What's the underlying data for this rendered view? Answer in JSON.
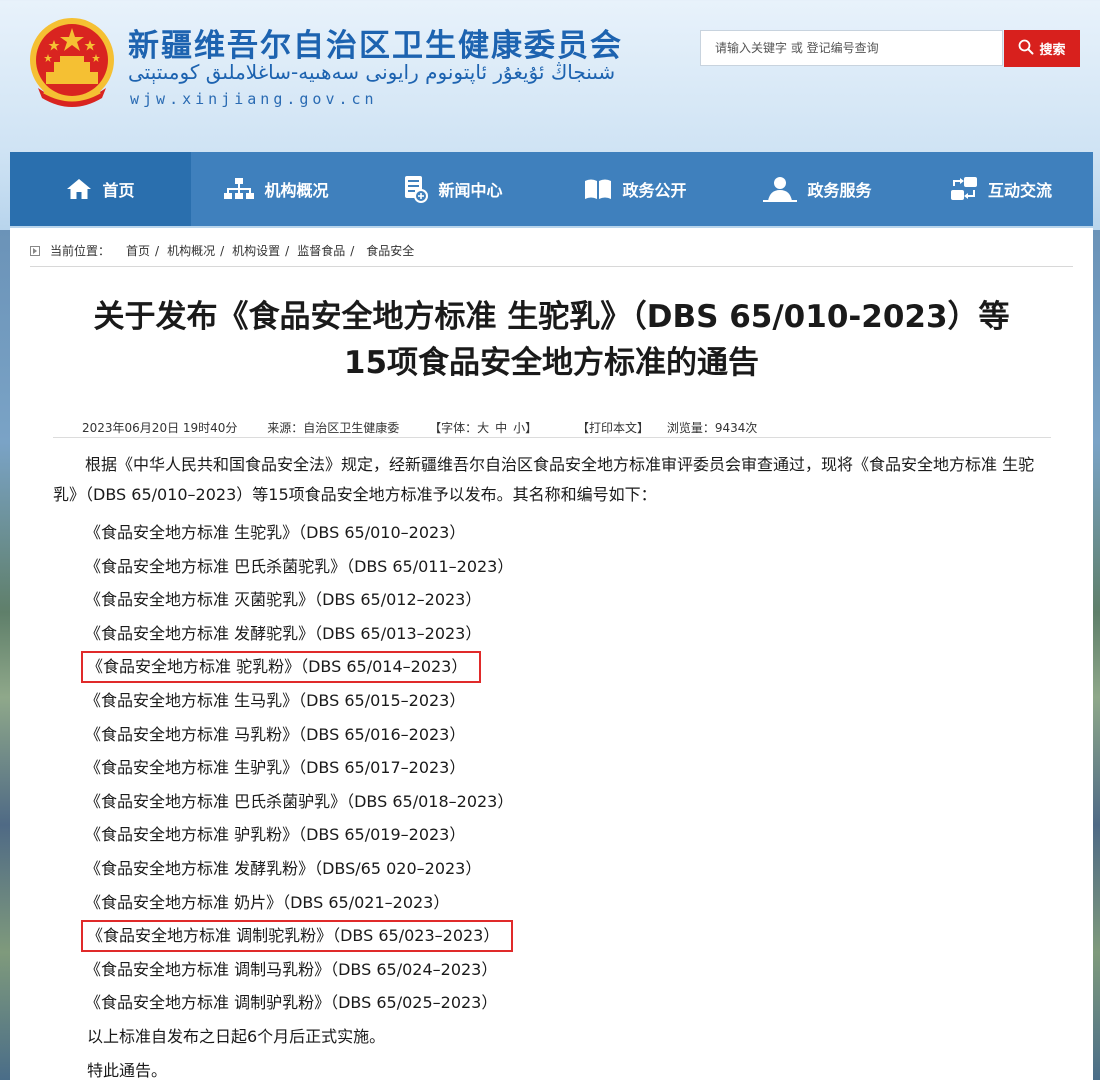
{
  "header": {
    "site_title": "新疆维吾尔自治区卫生健康委员会",
    "site_title_uyghur": "شىنجاڭ ئۇيغۇر ئاپتونوم رايونى سەھىيە-ساغلاملىق كومىتېتى",
    "site_url": "wjw.xinjiang.gov.cn",
    "search_placeholder": "请输入关键字 或 登记编号查询",
    "search_button": "搜索"
  },
  "nav": {
    "items": [
      {
        "label": "首页",
        "icon": "home-icon"
      },
      {
        "label": "机构概况",
        "icon": "org-chart-icon"
      },
      {
        "label": "新闻中心",
        "icon": "news-icon"
      },
      {
        "label": "政务公开",
        "icon": "book-icon"
      },
      {
        "label": "政务服务",
        "icon": "service-icon"
      },
      {
        "label": "互动交流",
        "icon": "exchange-icon"
      }
    ],
    "active_index": 0
  },
  "breadcrumb": {
    "label": "当前位置：",
    "items": [
      "首页",
      "机构概况",
      "机构设置",
      "监督食品",
      "食品安全"
    ]
  },
  "article": {
    "title_line1": "关于发布《食品安全地方标准 生驼乳》（DBS 65/010-2023）等",
    "title_line2": "15项食品安全地方标准的通告",
    "meta": {
      "datetime": "2023年06月20日 19时40分",
      "source": "来源：自治区卫生健康委",
      "font_label": "【字体：",
      "font_large": "大",
      "font_medium": "中",
      "font_small": "小",
      "font_close": "】",
      "print": "【打印本文】",
      "views": "浏览量：9434次"
    },
    "intro": "根据《中华人民共和国食品安全法》规定，经新疆维吾尔自治区食品安全地方标准审评委员会审查通过，现将《食品安全地方标准 生驼乳》（DBS 65/010–2023）等15项食品安全地方标准予以发布。其名称和编号如下：",
    "standards": [
      {
        "text": "《食品安全地方标准 生驼乳》（DBS 65/010–2023）",
        "highlight": false
      },
      {
        "text": "《食品安全地方标准 巴氏杀菌驼乳》（DBS 65/011–2023）",
        "highlight": false
      },
      {
        "text": "《食品安全地方标准 灭菌驼乳》（DBS 65/012–2023）",
        "highlight": false
      },
      {
        "text": "《食品安全地方标准 发酵驼乳》（DBS 65/013–2023）",
        "highlight": false
      },
      {
        "text": "《食品安全地方标准 驼乳粉》（DBS 65/014–2023）",
        "highlight": true
      },
      {
        "text": "《食品安全地方标准 生马乳》（DBS 65/015–2023）",
        "highlight": false
      },
      {
        "text": "《食品安全地方标准 马乳粉》（DBS 65/016–2023）",
        "highlight": false
      },
      {
        "text": "《食品安全地方标准 生驴乳》（DBS 65/017–2023）",
        "highlight": false
      },
      {
        "text": "《食品安全地方标准 巴氏杀菌驴乳》（DBS 65/018–2023）",
        "highlight": false
      },
      {
        "text": "《食品安全地方标准 驴乳粉》（DBS 65/019–2023）",
        "highlight": false
      },
      {
        "text": "《食品安全地方标准 发酵乳粉》（DBS/65 020–2023）",
        "highlight": false
      },
      {
        "text": "《食品安全地方标准 奶片》（DBS 65/021–2023）",
        "highlight": false
      },
      {
        "text": "《食品安全地方标准 调制驼乳粉》（DBS 65/023–2023）",
        "highlight": true
      },
      {
        "text": "《食品安全地方标准 调制马乳粉》（DBS 65/024–2023）",
        "highlight": false
      },
      {
        "text": "《食品安全地方标准 调制驴乳粉》（DBS 65/025–2023）",
        "highlight": false
      }
    ],
    "closing": "以上标准自发布之日起6个月后正式实施。",
    "sign_off": "特此通告。"
  },
  "colors": {
    "brand_blue": "#1d63b0",
    "nav_blue": "#3f80bd",
    "nav_active": "#2a6fae",
    "search_red": "#d8201d",
    "highlight_red": "#e02a2a"
  }
}
